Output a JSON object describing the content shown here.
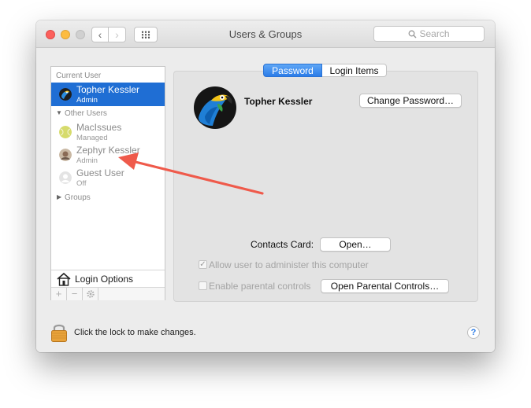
{
  "window": {
    "title": "Users & Groups",
    "search_placeholder": "Search",
    "back_glyph": "‹",
    "forward_glyph": "›"
  },
  "sidebar": {
    "current_user_header": "Current User",
    "current_user": {
      "name": "Topher Kessler",
      "role": "Admin"
    },
    "other_users_header": "Other Users",
    "other_users": [
      {
        "name": "MacIssues",
        "role": "Managed"
      },
      {
        "name": "Zephyr Kessler",
        "role": "Admin"
      },
      {
        "name": "Guest User",
        "role": "Off"
      }
    ],
    "groups_label": "Groups",
    "login_options_label": "Login Options",
    "add_glyph": "+",
    "remove_glyph": "−"
  },
  "tabs": {
    "password": "Password",
    "login_items": "Login Items"
  },
  "detail": {
    "user_name": "Topher Kessler",
    "change_password_button": "Change Password…",
    "contacts_card_label": "Contacts Card:",
    "open_button": "Open…",
    "allow_admin_label": "Allow user to administer this computer",
    "allow_admin_checked": true,
    "parental_controls_label": "Enable parental controls",
    "parental_controls_checked": false,
    "open_parental_button": "Open Parental Controls…"
  },
  "footer": {
    "lock_text": "Click the lock to make changes.",
    "help_glyph": "?"
  },
  "colors": {
    "selection": "#1f6ed4",
    "segment_active": "#2b7ce8",
    "annotation_arrow": "#ef5a4b"
  }
}
